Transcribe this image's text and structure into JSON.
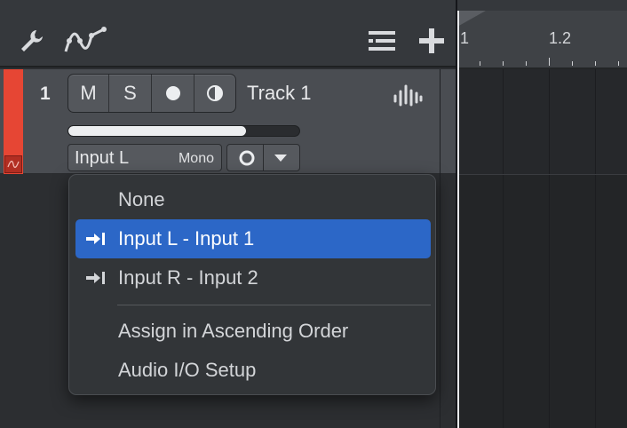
{
  "toolbar": {
    "wrench_icon": "wrench-icon",
    "automation_curve_icon": "automation-curve-icon",
    "list_icon": "list-view-icon",
    "add_icon": "plus-icon"
  },
  "track": {
    "number": "1",
    "name": "Track 1",
    "color": "#e64634",
    "mute_label": "M",
    "solo_label": "S",
    "volume_level": 0.77,
    "input": "Input L",
    "channel_mode": "Mono"
  },
  "ruler": {
    "labels": [
      "1",
      "1.2"
    ]
  },
  "input_menu": {
    "items": [
      {
        "label": "None",
        "icon": null,
        "selected": false
      },
      {
        "label": "Input L - Input 1",
        "icon": "audio-input-icon",
        "selected": true
      },
      {
        "label": "Input R - Input 2",
        "icon": "audio-input-icon",
        "selected": false
      },
      {
        "label": "Assign in Ascending Order",
        "icon": null,
        "selected": false
      },
      {
        "label": "Audio I/O Setup",
        "icon": null,
        "selected": false
      }
    ]
  },
  "colors": {
    "selection": "#2c67c7",
    "track_color": "#e64634"
  }
}
